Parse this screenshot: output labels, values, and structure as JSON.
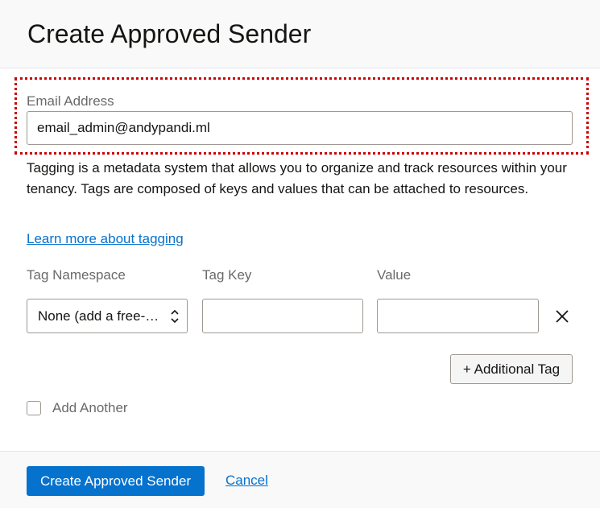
{
  "header": {
    "title": "Create Approved Sender"
  },
  "email": {
    "label": "Email Address",
    "value": "email_admin@andypandi.ml"
  },
  "tagging": {
    "description": "Tagging is a metadata system that allows you to organize and track resources within your tenancy. Tags are composed of keys and values that can be attached to resources.",
    "learn_more_link": "Learn more about tagging",
    "columns": {
      "namespace": "Tag Namespace",
      "key": "Tag Key",
      "value": "Value"
    },
    "row": {
      "namespace_selected": "None (add a free-form tag)",
      "key_value": "",
      "value_value": ""
    },
    "additional_tag_button": "+ Additional Tag"
  },
  "add_another": {
    "label": "Add Another",
    "checked": false
  },
  "footer": {
    "primary_button": "Create Approved Sender",
    "cancel_link": "Cancel"
  },
  "colors": {
    "primary": "#0572ce",
    "highlight_border": "#cc0000"
  },
  "icons": {
    "select_arrows": "chevron-up-down-icon",
    "remove": "close-icon"
  }
}
